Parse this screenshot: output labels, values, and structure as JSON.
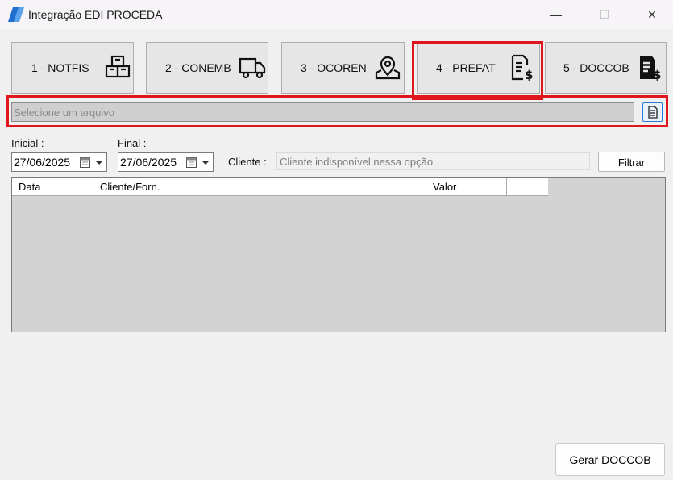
{
  "window": {
    "title": "Integração EDI PROCEDA",
    "controls": {
      "minimize": "—",
      "maximize": "☐",
      "close": "✕"
    }
  },
  "tabs": [
    {
      "label": "1 - NOTFIS",
      "icon": "boxes-icon"
    },
    {
      "label": "2 - CONEMB",
      "icon": "truck-icon"
    },
    {
      "label": "3 - OCOREN",
      "icon": "map-pin-icon"
    },
    {
      "label": "4 - PREFAT",
      "icon": "invoice-dollar-icon",
      "highlighted": true
    },
    {
      "label": "5 - DOCCOB",
      "icon": "document-dollar-filled-icon"
    }
  ],
  "file": {
    "placeholder": "Selecione um arquivo",
    "highlighted": true,
    "browse_icon": "document-icon"
  },
  "filters": {
    "inicial_label": "Inicial :",
    "inicial_value": "27/06/2025",
    "final_label": "Final :",
    "final_value": "27/06/2025",
    "cliente_label": "Cliente :",
    "cliente_placeholder": "Cliente indisponível nessa opção",
    "filter_button": "Filtrar"
  },
  "grid": {
    "columns": [
      "Data",
      "Cliente/Forn.",
      "Valor",
      ""
    ]
  },
  "footer": {
    "generate_button": "Gerar DOCCOB"
  },
  "colors": {
    "highlight": "#e0161f",
    "accent": "#2a79d6"
  }
}
